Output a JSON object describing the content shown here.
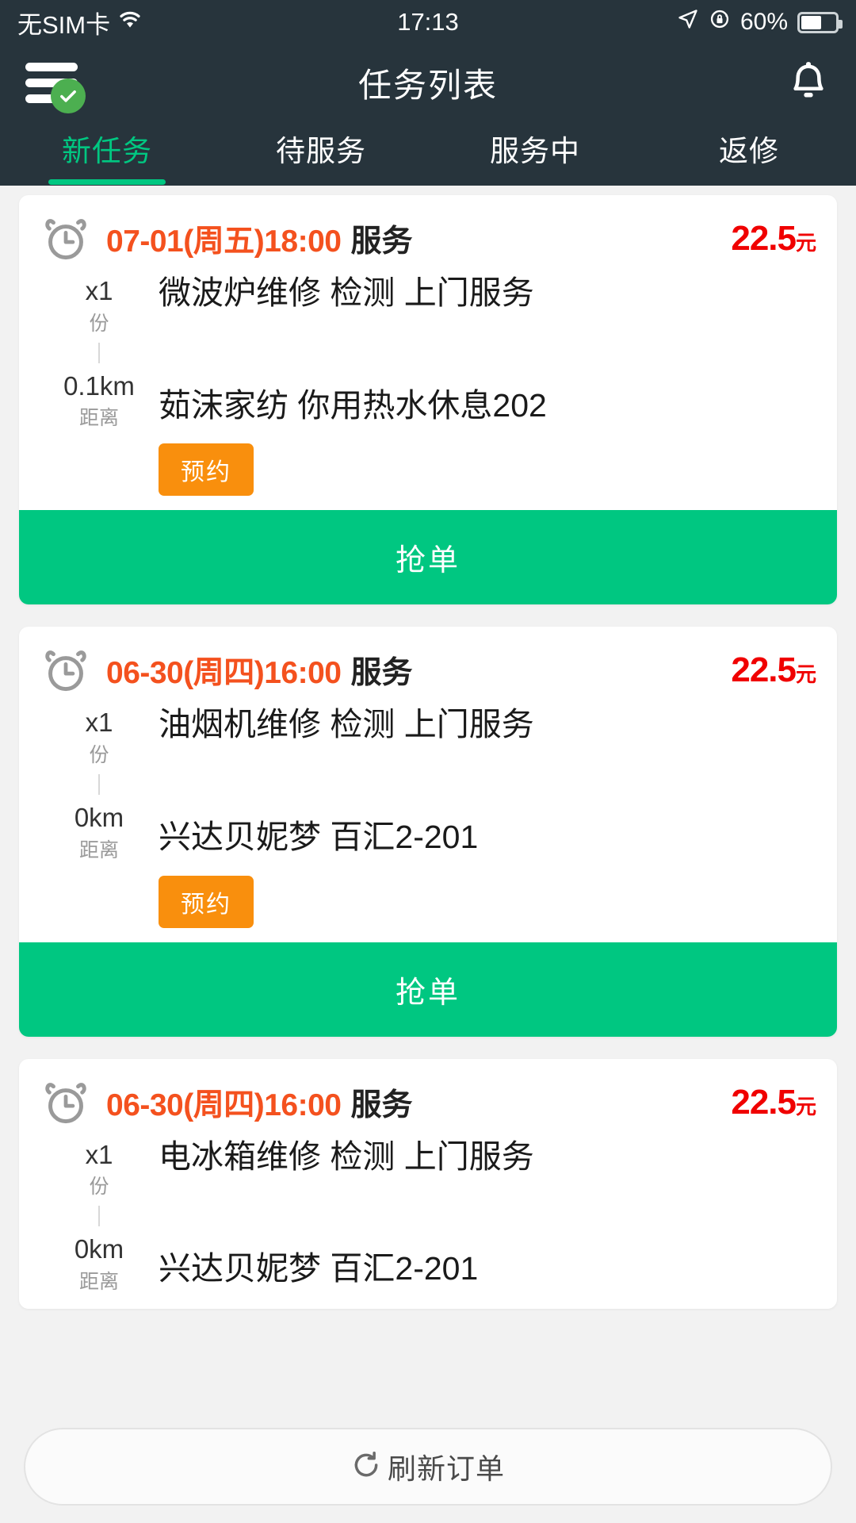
{
  "status_bar": {
    "carrier": "无SIM卡",
    "wifi_icon": "wifi-icon",
    "time": "17:13",
    "location_icon": "location-arrow-icon",
    "rotation_lock_icon": "rotation-lock-icon",
    "battery_percent": "60%",
    "battery_icon": "battery-icon"
  },
  "navbar": {
    "menu_icon": "hamburger-menu-icon",
    "menu_badge_icon": "check-badge-icon",
    "title": "任务列表",
    "bell_icon": "notification-bell-icon"
  },
  "tabs": {
    "active_index": 0,
    "items": [
      {
        "label": "新任务"
      },
      {
        "label": "待服务"
      },
      {
        "label": "服务中"
      },
      {
        "label": "返修"
      }
    ]
  },
  "orders": [
    {
      "clock_icon": "alarm-clock-icon",
      "time_date": "07-01(周五)18:00",
      "time_suffix": "服务",
      "price_value": "22.5",
      "price_unit": "元",
      "qty_main": "x1",
      "qty_sub": "份",
      "service": "微波炉维修 检测 上门服务",
      "distance_main": "0.1km",
      "distance_sub": "距离",
      "address": "茹沫家纺 你用热水休息202",
      "badge": "预约",
      "action_label": "抢单"
    },
    {
      "clock_icon": "alarm-clock-icon",
      "time_date": "06-30(周四)16:00",
      "time_suffix": "服务",
      "price_value": "22.5",
      "price_unit": "元",
      "qty_main": "x1",
      "qty_sub": "份",
      "service": "油烟机维修 检测 上门服务",
      "distance_main": "0km",
      "distance_sub": "距离",
      "address": "兴达贝妮梦 百汇2-201",
      "badge": "预约",
      "action_label": "抢单"
    },
    {
      "clock_icon": "alarm-clock-icon",
      "time_date": "06-30(周四)16:00",
      "time_suffix": "服务",
      "price_value": "22.5",
      "price_unit": "元",
      "qty_main": "x1",
      "qty_sub": "份",
      "service": "电冰箱维修 检测 上门服务",
      "distance_main": "0km",
      "distance_sub": "距离",
      "address": "兴达贝妮梦 百汇2-201",
      "badge": "",
      "action_label": ""
    }
  ],
  "bottom": {
    "refresh_icon": "refresh-circle-icon",
    "refresh_label": "刷新订单"
  },
  "colors": {
    "header_bg": "#27343c",
    "accent_green": "#00c781",
    "badge_orange": "#f98f0d",
    "time_orange": "#f4511e",
    "price_red": "#f00000",
    "page_bg": "#f2f2f2"
  }
}
